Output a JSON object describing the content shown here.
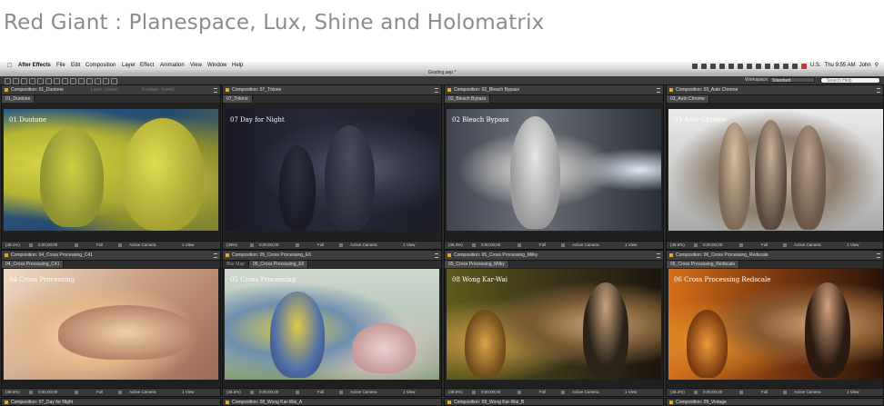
{
  "heading": "Red Giant : Planespace, Lux, Shine and Holomatrix",
  "menubar": {
    "app": "After Effects",
    "items": [
      "File",
      "Edit",
      "Composition",
      "Layer",
      "Effect",
      "Animation",
      "View",
      "Window",
      "Help"
    ],
    "clock": "Thu 9:55 AM",
    "user": "John",
    "region": "U.S."
  },
  "window_title": "Grading.aep *",
  "toolbar": {
    "workspace_label": "Workspace:",
    "workspace_value": "Standard",
    "search_placeholder": "Search Help"
  },
  "panels": [
    {
      "tab": "Composition: 01_Duotone",
      "tab2": "Layer: (none)",
      "tab3": "Footage: (none)",
      "sub": "01_Duotone",
      "title": "01 Duotone",
      "zoom": "(49.1%)",
      "timecode": "0;00;00;00",
      "res": "Full",
      "camera": "Active Camera",
      "view": "1 View"
    },
    {
      "tab": "Composition: 07_Tritone",
      "tab2": "",
      "tab3": "",
      "sub": "07_Tritone",
      "title": "07 Day for Night",
      "zoom": "(49%)",
      "timecode": "0;00;00;00",
      "res": "Full",
      "camera": "Active Camera",
      "view": "1 View"
    },
    {
      "tab": "Composition: 02_Bleach Bypass",
      "tab2": "",
      "tab3": "",
      "sub": "02_Bleach Bypass",
      "title": "02 Bleach Bypass",
      "zoom": "(48.3%)",
      "timecode": "0;00;00;00",
      "res": "Full",
      "camera": "Active Camera",
      "view": "1 View"
    },
    {
      "tab": "Composition: 03_Auto Chrome",
      "tab2": "",
      "tab3": "",
      "sub": "03_Auto Chrome",
      "title": "03 Auto Chrome",
      "zoom": "(48.8%)",
      "timecode": "0;00;00;00",
      "res": "Full",
      "camera": "Active Camera",
      "view": "1 View"
    },
    {
      "tab": "Composition: 04_Cross Processing_C41",
      "tab2": "",
      "tab3": "",
      "sub": "04_Cross Processing_C41",
      "title": "04 Cross Processing",
      "zoom": "(48.5%)",
      "timecode": "0;00;00;00",
      "res": "Full",
      "camera": "Active Camera",
      "view": "1 View"
    },
    {
      "tab": "Composition: 05_Cross Processing_E6",
      "tab2": "",
      "tab3": "",
      "sub": "05_Cross Processing_E6",
      "sub_prefix": "Blur Map",
      "title": "05 Cross Processing",
      "zoom": "(48.5%)",
      "timecode": "0;00;00;00",
      "res": "Full",
      "camera": "Active Camera",
      "view": "1 View"
    },
    {
      "tab": "Composition: 05_Cross Processing_Milky",
      "tab2": "",
      "tab3": "",
      "sub": "05_Cross Processing_Milky",
      "title": "08 Wong Kar-Wai",
      "zoom": "(48.5%)",
      "timecode": "0;00;00;00",
      "res": "Full",
      "camera": "Active Camera",
      "view": "1 View"
    },
    {
      "tab": "Composition: 06_Cross Processing_Redscale",
      "tab2": "",
      "tab3": "",
      "sub": "06_Cross Processing_Redscale",
      "title": "06 Cross Processing Redscale",
      "zoom": "(48.2%)",
      "timecode": "0;00;00;00",
      "res": "Full",
      "camera": "Active Camera",
      "view": "1 View"
    }
  ],
  "bottom_tabs": [
    "Composition: 07_Day for Night",
    "Composition: 08_Wong Kar-Wai_A",
    "Composition: 09_Wong Kar-Wai_B",
    "Composition: 09_Vintage"
  ]
}
